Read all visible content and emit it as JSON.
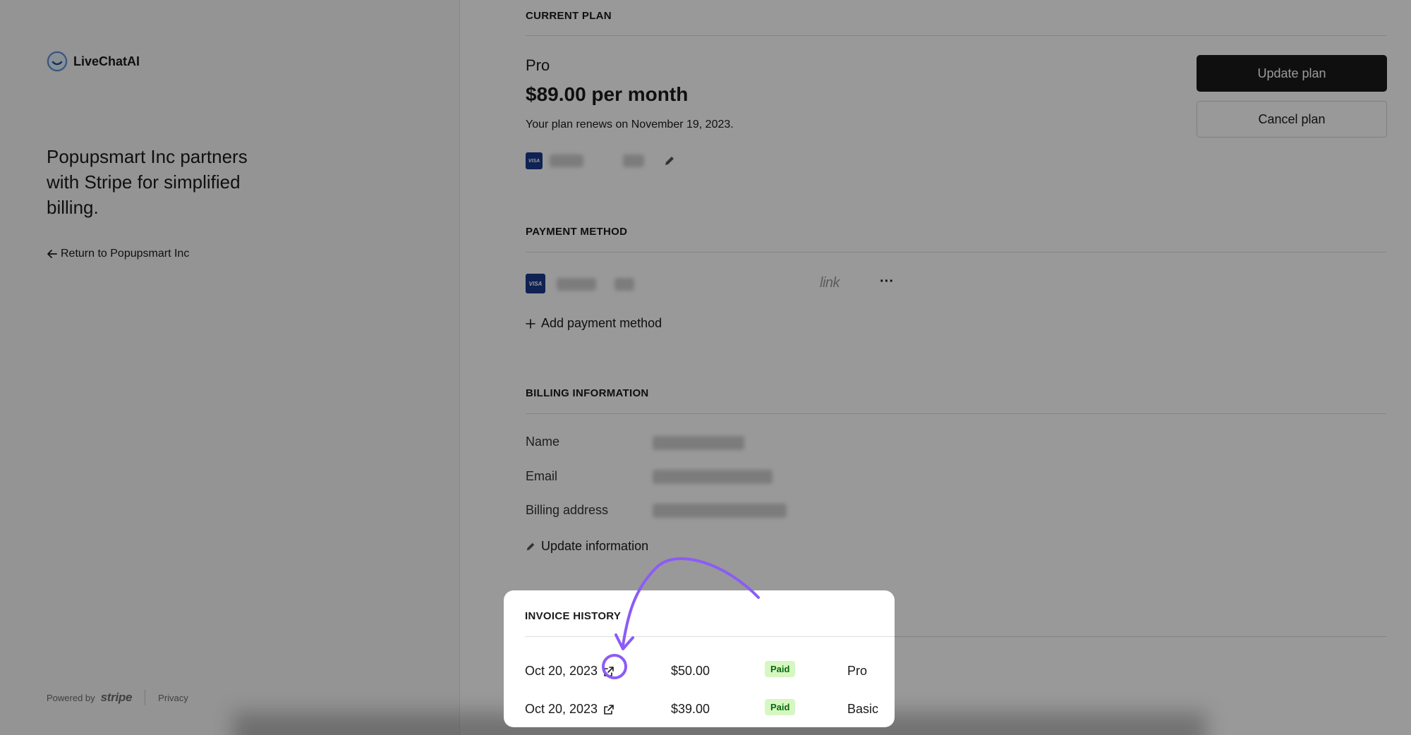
{
  "brand": {
    "name": "LiveChatAI"
  },
  "left": {
    "tagline": "Popupsmart Inc partners with Stripe for simplified billing.",
    "return_label": "Return to Popupsmart Inc"
  },
  "footer": {
    "powered_by": "Powered by",
    "stripe": "stripe",
    "privacy": "Privacy"
  },
  "current_plan": {
    "title": "CURRENT PLAN",
    "plan_name": "Pro",
    "price": "$89.00 per month",
    "renew_text": "Your plan renews on November 19, 2023.",
    "card_brand": "VISA",
    "update_button": "Update plan",
    "cancel_button": "Cancel plan"
  },
  "payment_method": {
    "title": "PAYMENT METHOD",
    "card_brand": "VISA",
    "link_label": "link",
    "more_label": "···",
    "add_label": "Add payment method"
  },
  "billing_info": {
    "title": "BILLING INFORMATION",
    "name_label": "Name",
    "email_label": "Email",
    "address_label": "Billing address",
    "update_label": "Update information"
  },
  "invoice_history": {
    "title": "INVOICE HISTORY",
    "rows": [
      {
        "date": "Oct 20, 2023",
        "amount": "$50.00",
        "status": "Paid",
        "plan": "Pro"
      },
      {
        "date": "Oct 20, 2023",
        "amount": "$39.00",
        "status": "Paid",
        "plan": "Basic"
      }
    ]
  },
  "colors": {
    "accent_annotation": "#8b5cf6",
    "badge_bg": "#d7f7c2",
    "badge_text": "#05690d",
    "primary_button": "#1a1a1a"
  },
  "icons": {
    "back": "arrow-left-icon",
    "edit": "pencil-icon",
    "add": "plus-icon",
    "external": "external-link-icon",
    "more": "ellipsis-icon"
  }
}
